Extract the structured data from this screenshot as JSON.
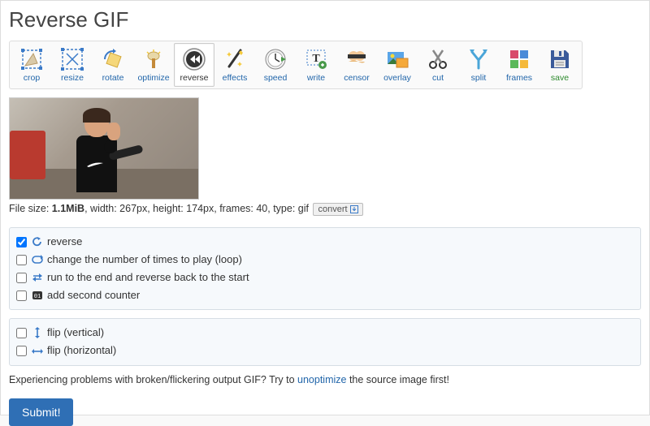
{
  "page_title": "Reverse GIF",
  "toolbar": [
    {
      "id": "crop",
      "label": "crop"
    },
    {
      "id": "resize",
      "label": "resize"
    },
    {
      "id": "rotate",
      "label": "rotate"
    },
    {
      "id": "optimize",
      "label": "optimize"
    },
    {
      "id": "reverse",
      "label": "reverse"
    },
    {
      "id": "effects",
      "label": "effects"
    },
    {
      "id": "speed",
      "label": "speed"
    },
    {
      "id": "write",
      "label": "write"
    },
    {
      "id": "censor",
      "label": "censor"
    },
    {
      "id": "overlay",
      "label": "overlay"
    },
    {
      "id": "cut",
      "label": "cut"
    },
    {
      "id": "split",
      "label": "split"
    },
    {
      "id": "frames",
      "label": "frames"
    },
    {
      "id": "save",
      "label": "save"
    }
  ],
  "file_info": {
    "size_label": "File size: ",
    "size_value": "1.1MiB",
    "width_label": ", width: ",
    "width_value": "267px",
    "height_label": ", height: ",
    "height_value": "174px",
    "frames_label": ", frames: ",
    "frames_value": "40",
    "type_label": ", type: ",
    "type_value": "gif",
    "convert_label": "convert"
  },
  "options_main": [
    {
      "id": "reverse",
      "label": "reverse",
      "checked": true
    },
    {
      "id": "loop",
      "label": "change the number of times to play (loop)",
      "checked": false
    },
    {
      "id": "boomerang",
      "label": "run to the end and reverse back to the start",
      "checked": false
    },
    {
      "id": "counter",
      "label": "add second counter",
      "checked": false
    }
  ],
  "options_flip": [
    {
      "id": "flipv",
      "label": "flip (vertical)",
      "checked": false
    },
    {
      "id": "fliph",
      "label": "flip (horizontal)",
      "checked": false
    }
  ],
  "hint": {
    "before": "Experiencing problems with broken/flickering output GIF? Try to ",
    "link": "unoptimize",
    "after": " the source image first!"
  },
  "submit_label": "Submit!"
}
